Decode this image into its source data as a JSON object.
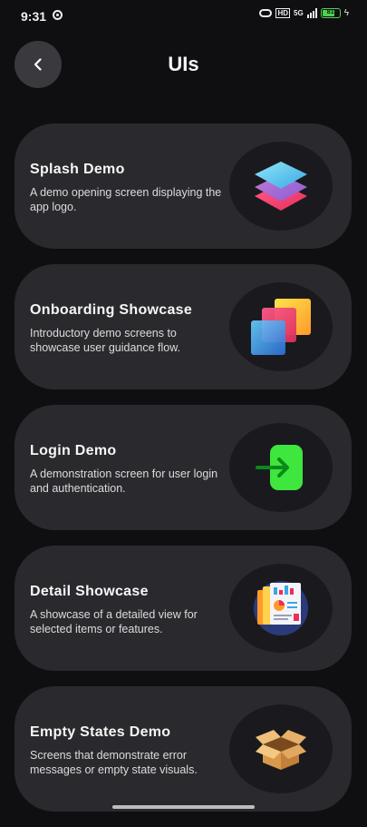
{
  "status_bar": {
    "time": "9:31",
    "hd": "HD",
    "network": "5G",
    "battery": "81",
    "battery_color": "#4fd14f"
  },
  "header": {
    "title": "UIs",
    "back_icon": "chevron-left-icon"
  },
  "cards": [
    {
      "title": "Splash Demo",
      "description": "A demo opening screen displaying the app logo.",
      "icon": "stacked-layers-icon"
    },
    {
      "title": "Onboarding Showcase",
      "description": "Introductory demo screens to showcase user guidance flow.",
      "icon": "overlapping-squares-icon"
    },
    {
      "title": "Login Demo",
      "description": "A demonstration screen for user login and authentication.",
      "icon": "login-arrow-icon"
    },
    {
      "title": "Detail Showcase",
      "description": "A showcase of a detailed view for selected items or features.",
      "icon": "report-documents-icon"
    },
    {
      "title": "Empty States Demo",
      "description": "Screens that demonstrate error messages or empty state visuals.",
      "icon": "open-box-icon"
    }
  ],
  "colors": {
    "background": "#0f0f12",
    "card": "#2a2a2e",
    "icon_circle": "#1a1a1e",
    "accent_green": "#3ee63e"
  }
}
